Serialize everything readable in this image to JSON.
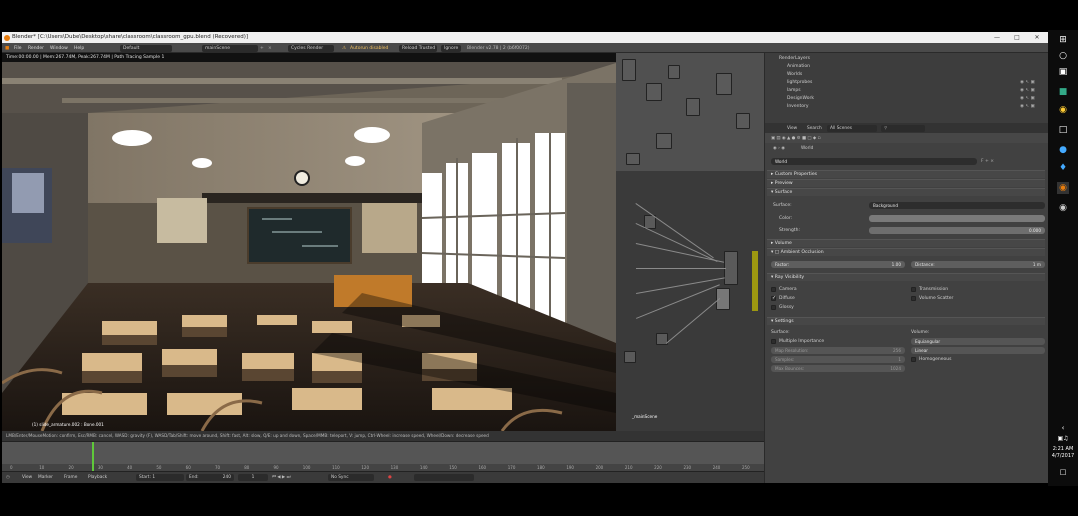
{
  "window": {
    "title": "Blender* [C:\\Users\\Dube\\Desktop\\share\\classroom\\classroom_gpu.blend (Recovered)]"
  },
  "info": {
    "menus": [
      "File",
      "Render",
      "Window",
      "Help"
    ],
    "layout": "Default",
    "scene": "mainScene",
    "engine": "Cycles Render",
    "warning": "Autorun disabled",
    "reload": "Reload Trusted",
    "ignore": "Ignore",
    "stats": "Blender v2.78 | 2 (b6f0072)"
  },
  "viewport": {
    "header": "Time:00:00.00 | Mem:267.74M, Peak:267.74M | Path Tracing Sample 1",
    "object_label": "(1) slide_armature.002 : Bone.001"
  },
  "nodes": {
    "label": "_mainScene",
    "menu": [
      "View",
      "Select",
      "Add",
      "Node"
    ],
    "use_nodes": "Use"
  },
  "outliner": {
    "items": [
      "RenderLayers",
      "Animation",
      "Worlds",
      "lightprobes",
      "lamps",
      "DesignWork",
      "Inventory"
    ],
    "view": "View",
    "search": "Search",
    "filter": "All Scenes"
  },
  "properties": {
    "breadcrumb": "World",
    "world_name": "World",
    "panels": {
      "custom": "Custom Properties",
      "preview": "Preview",
      "surface": "Surface",
      "volume": "Volume",
      "ao": "Ambient Occlusion",
      "ray": "Ray Visibility",
      "settings": "Settings"
    },
    "surface_label": "Surface:",
    "surface_value": "Background",
    "color_label": "Color:",
    "strength_label": "Strength:",
    "strength_value": "0.000",
    "factor_label": "Factor:",
    "factor_value": "1.00",
    "distance_label": "Distance:",
    "distance_value": "1 m",
    "ray": {
      "camera": "Camera",
      "transmission": "Transmission",
      "diffuse": "Diffuse",
      "volume_scatter": "Volume Scatter",
      "glossy": "Glossy"
    },
    "settings": {
      "surface_label": "Surface:",
      "volume_label": "Volume:",
      "multiple_importance": "Multiple Importance",
      "map_resolution_label": "Map Resolution:",
      "map_resolution_value": "256",
      "samples_label": "Samples:",
      "samples_value": "1",
      "max_bounces_label": "Max Bounces:",
      "max_bounces_value": "1024",
      "volume_sampling": "Equiangular",
      "interpolation": "Linear",
      "homogeneous": "Homogeneous"
    }
  },
  "statusbar": {
    "hint": "LMB/Enter/MouseMotion: confirm, Esc/RMB: cancel, WASD: gravity (F), WASD/Tab/Shift: move around, Shift: fast, Alt: slow, Q/E: up and down, Space/MMB: teleport, V: jump, Ctrl-Wheel: increase speed, Wheel/Down: decrease speed"
  },
  "timeline": {
    "ticks": [
      "0",
      "10",
      "20",
      "30",
      "40",
      "50",
      "60",
      "70",
      "80",
      "90",
      "100",
      "110",
      "120",
      "130",
      "140",
      "150",
      "160",
      "170",
      "180",
      "190",
      "200",
      "210",
      "220",
      "230",
      "240",
      "250"
    ],
    "current_frame_fraction": 0.1,
    "menu": [
      "View",
      "Marker",
      "Frame",
      "Playback"
    ],
    "start_label": "Start:",
    "start_value": "1",
    "end_label": "End:",
    "end_value": "240",
    "frame_value": "1",
    "sync": "No Sync"
  },
  "taskbar": {
    "time": "2:21 AM",
    "date": "4/7/2017"
  },
  "colors": {
    "accent": "#e87d0d",
    "blender_bg": "#3c3c3c"
  }
}
